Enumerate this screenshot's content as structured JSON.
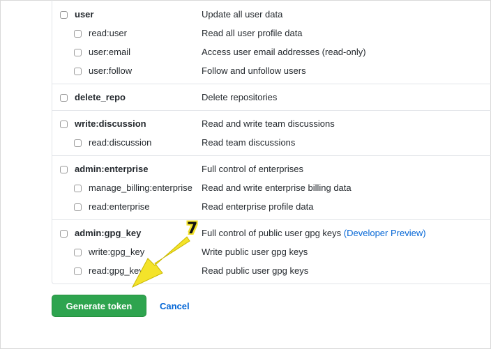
{
  "scope_groups": [
    {
      "parent": {
        "name": "user",
        "description": "Update all user data"
      },
      "children": [
        {
          "name": "read:user",
          "description": "Read all user profile data"
        },
        {
          "name": "user:email",
          "description": "Access user email addresses (read-only)"
        },
        {
          "name": "user:follow",
          "description": "Follow and unfollow users"
        }
      ]
    },
    {
      "parent": {
        "name": "delete_repo",
        "description": "Delete repositories"
      },
      "children": []
    },
    {
      "parent": {
        "name": "write:discussion",
        "description": "Read and write team discussions"
      },
      "children": [
        {
          "name": "read:discussion",
          "description": "Read team discussions"
        }
      ]
    },
    {
      "parent": {
        "name": "admin:enterprise",
        "description": "Full control of enterprises"
      },
      "children": [
        {
          "name": "manage_billing:enterprise",
          "description": "Read and write enterprise billing data"
        },
        {
          "name": "read:enterprise",
          "description": "Read enterprise profile data"
        }
      ]
    },
    {
      "parent": {
        "name": "admin:gpg_key",
        "description": "Full control of public user gpg keys",
        "badge": "(Developer Preview)"
      },
      "children": [
        {
          "name": "write:gpg_key",
          "description": "Write public user gpg keys"
        },
        {
          "name": "read:gpg_key",
          "description": "Read public user gpg keys"
        }
      ]
    }
  ],
  "actions": {
    "generate_label": "Generate token",
    "cancel_label": "Cancel"
  },
  "annotation": {
    "step_number": "7",
    "color": "#f4e32a"
  },
  "colors": {
    "primary_button": "#2ea44f",
    "link": "#0366d6"
  }
}
